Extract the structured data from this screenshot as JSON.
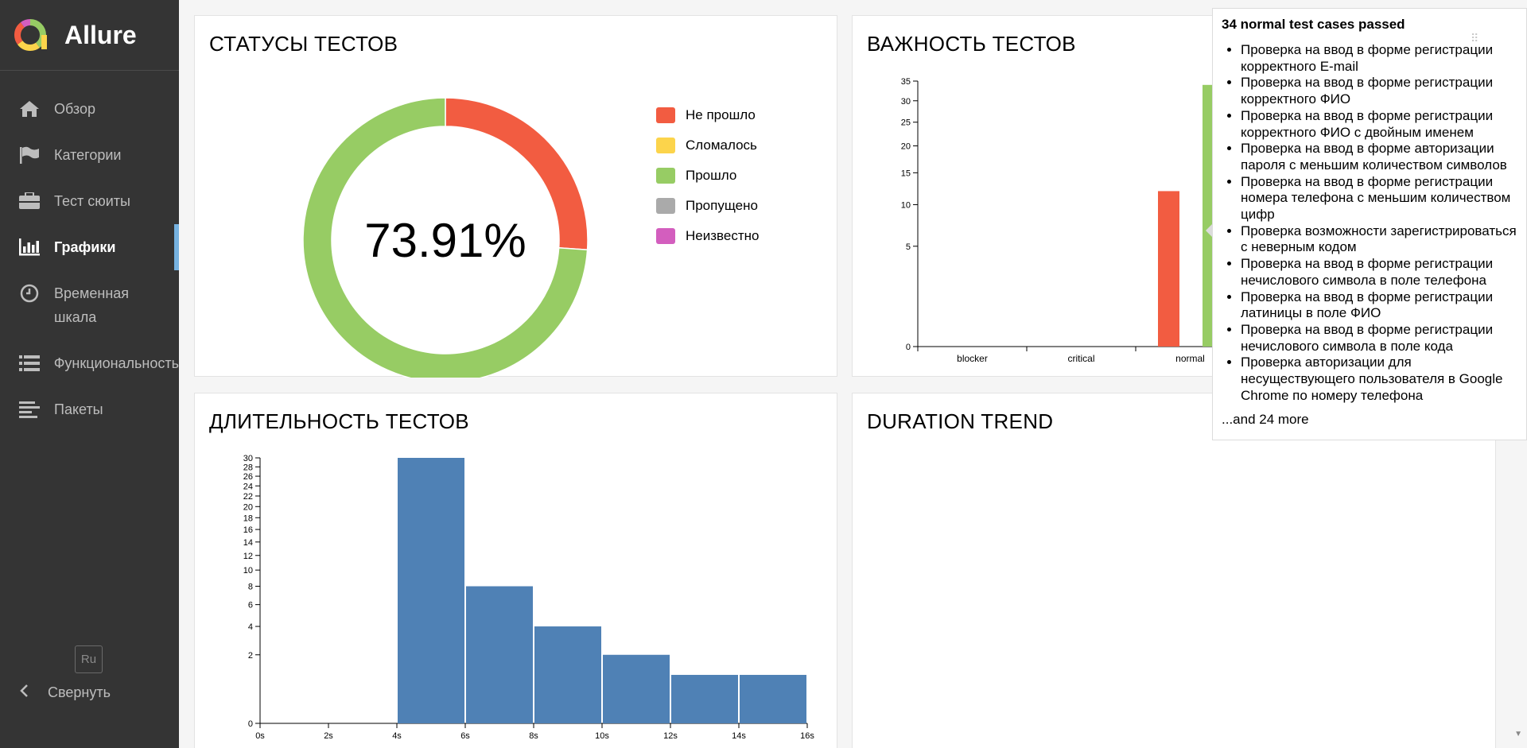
{
  "app": {
    "name": "Allure"
  },
  "sidebar": {
    "items": [
      {
        "label": "Обзор",
        "icon": "home-icon"
      },
      {
        "label": "Категории",
        "icon": "flag-icon"
      },
      {
        "label": "Тест сюиты",
        "icon": "briefcase-icon"
      },
      {
        "label": "Графики",
        "icon": "bar-chart-icon",
        "active": true
      },
      {
        "label": "Временная",
        "label2": "шкала",
        "icon": "clock-icon"
      },
      {
        "label": "Функциональность",
        "icon": "list-icon"
      },
      {
        "label": "Пакеты",
        "icon": "align-left-icon"
      }
    ],
    "language": "Ru",
    "collapse_label": "Свернуть"
  },
  "cards": {
    "status": {
      "title": "СТАТУСЫ ТЕСТОВ",
      "percent": "73.91%"
    },
    "severity": {
      "title": "ВАЖНОСТЬ ТЕСТОВ"
    },
    "duration": {
      "title": "ДЛИТЕЛЬНОСТЬ ТЕСТОВ"
    },
    "trend": {
      "title": "DURATION TREND"
    }
  },
  "legend": [
    {
      "label": "Не прошло",
      "color": "#f25c41"
    },
    {
      "label": "Сломалось",
      "color": "#fcd44b"
    },
    {
      "label": "Прошло",
      "color": "#97cc64"
    },
    {
      "label": "Пропущено",
      "color": "#aaaaaa"
    },
    {
      "label": "Неизвестно",
      "color": "#d35ebe"
    }
  ],
  "chart_data": [
    {
      "type": "pie",
      "categories": [
        "Не прошло",
        "Сломалось",
        "Прошло",
        "Пропущено",
        "Неизвестно"
      ],
      "values": [
        26.09,
        0,
        73.91,
        0,
        0
      ],
      "center_label": "73.91%",
      "colors": [
        "#f25c41",
        "#fcd44b",
        "#97cc64",
        "#aaaaaa",
        "#d35ebe"
      ]
    },
    {
      "type": "bar",
      "categories": [
        "blocker",
        "critical",
        "normal"
      ],
      "series": [
        {
          "values": [
            0,
            0,
            12
          ],
          "color": "#f25c41"
        },
        {
          "values": [
            0,
            0,
            34
          ],
          "color": "#97cc64"
        }
      ],
      "yscale": "sqrt",
      "yticks": [
        0,
        5,
        10,
        15,
        20,
        25,
        30,
        35
      ],
      "ylim": [
        0,
        35
      ]
    },
    {
      "type": "bar",
      "categories": [
        "4s-6s",
        "6s-8s",
        "8s-10s",
        "10s-12s",
        "12s-14s",
        "14s-16s"
      ],
      "x_edges": [
        4,
        6,
        8,
        10,
        12,
        14,
        16
      ],
      "values": [
        30,
        8,
        4,
        2,
        1,
        1
      ],
      "xticks": [
        "0s",
        "2s",
        "4s",
        "6s",
        "8s",
        "10s",
        "12s",
        "14s",
        "16s"
      ],
      "xlim": [
        0,
        16
      ],
      "yscale": "sqrt",
      "yticks": [
        0,
        2,
        4,
        6,
        8,
        10,
        12,
        14,
        16,
        18,
        20,
        22,
        24,
        26,
        28,
        30
      ],
      "ylim": [
        0,
        30
      ],
      "color": "#4f81b5"
    }
  ],
  "tooltip": {
    "title": "34 normal test cases passed",
    "items": [
      "Проверка на ввод в форме регистрации корректного E-mail",
      "Проверка на ввод в форме регистрации корректного ФИО",
      "Проверка на ввод в форме регистрации корректного ФИО с двойным именем",
      "Проверка на ввод в форме авторизации пароля с меньшим количеством символов",
      "Проверка на ввод в форме регистрации номера телефона с меньшим количеством цифр",
      "Проверка возможности зарегистрироваться с неверным кодом",
      "Проверка на ввод в форме регистрации нечислового символа в поле телефона",
      "Проверка на ввод в форме регистрации латиницы в поле ФИО",
      "Проверка на ввод в форме регистрации нечислового символа в поле кода",
      "Проверка авторизации для несуществующего пользователя в Google Chrome по номеру телефона"
    ],
    "more": "...and 24 more"
  }
}
